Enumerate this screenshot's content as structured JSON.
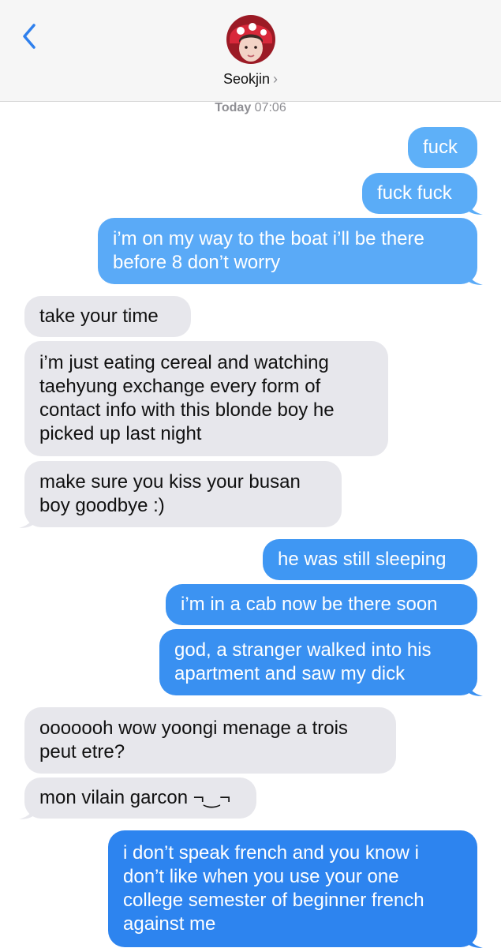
{
  "header": {
    "back_icon": "chevron-left-icon",
    "contact_name": "Seokjin",
    "contact_chevron": "›",
    "accent": "#2f80ed"
  },
  "timestamp": {
    "day": "Today",
    "time": "07:06"
  },
  "messages": [
    {
      "from": "me",
      "text": "fuck",
      "color": "#5eb0f8"
    },
    {
      "from": "me",
      "text": "fuck fuck",
      "color": "#5aacf7"
    },
    {
      "from": "me",
      "text": "i’m on my way to the boat i’ll be there\nbefore 8 don’t worry",
      "color": "#5aaaf7"
    },
    {
      "from": "them",
      "text": "take your time"
    },
    {
      "from": "them",
      "text": "i’m just eating cereal and watching\ntaehyung exchange every form of\ncontact info with this blonde boy he\npicked up last night"
    },
    {
      "from": "them",
      "text": "make sure you kiss your busan\nboy goodbye :)"
    },
    {
      "from": "me",
      "text": "he was still sleeping",
      "color": "#3f97f3"
    },
    {
      "from": "me",
      "text": "i’m in a cab now be there soon",
      "color": "#3c93f2"
    },
    {
      "from": "me",
      "text": "god, a stranger walked into his\napartment and saw my dick",
      "color": "#3990f1"
    },
    {
      "from": "them",
      "text": "ooooooh wow yoongi menage a trois\npeut etre?"
    },
    {
      "from": "them",
      "text": "mon vilain garcon ¬‿¬"
    },
    {
      "from": "me",
      "text": "i don’t speak french and you know i\ndon’t like when you use your one\ncollege semester of beginner french\nagainst me",
      "color": "#2d84ef"
    }
  ]
}
